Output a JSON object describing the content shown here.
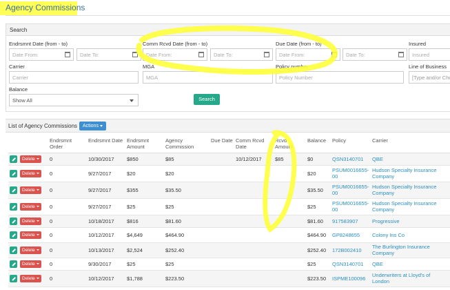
{
  "page": {
    "title": "Agency Commissions"
  },
  "search": {
    "heading": "Search",
    "endorsement_date_label": "Endrsmnt Date (from - to)",
    "comm_rcvd_date_label": "Comm Rcvd Date (from - to)",
    "due_date_label": "Due Date (from - to)",
    "insured_label": "Insured",
    "date_from_placeholder": "Date From:",
    "date_to_placeholder": "Date To:",
    "insured_placeholder": "Insured",
    "carrier_label": "Carrier",
    "carrier_placeholder": "Carrier",
    "mga_label": "MGA",
    "mga_placeholder": "MGA",
    "policy_number_label": "Policy number",
    "policy_number_placeholder": "Policy Number",
    "lob_label": "Line of Business",
    "lob_placeholder": "[Type and/or Che",
    "balance_label": "Balance",
    "balance_value": "Show All",
    "search_button": "Search"
  },
  "list": {
    "title": "List of Agency Commissions",
    "actions_button": "Actions",
    "delete_label": "Delete",
    "columns": [
      "",
      "Endrsmnt Order",
      "Endrsmnt Date",
      "Endrsmnt Amount",
      "Agency Commission",
      "Due Date",
      "Comm Rcvd Date",
      "Rcvd Amount",
      "Balance",
      "Policy",
      "Carrier"
    ],
    "rows": [
      {
        "order": "0",
        "date": "10/30/2017",
        "amount": "$850",
        "commission": "$85",
        "due": "",
        "comm_rcvd": "10/12/2017",
        "rcvd": "$85",
        "balance": "$0",
        "policy": "QSN3140701",
        "carrier": "QBE"
      },
      {
        "order": "0",
        "date": "9/27/2017",
        "amount": "$20",
        "commission": "$20",
        "due": "",
        "comm_rcvd": "",
        "rcvd": "",
        "balance": "$20",
        "policy": "PSUM0016655-00",
        "carrier": "Hudson Specialty Insurance Company"
      },
      {
        "order": "0",
        "date": "9/27/2017",
        "amount": "$355",
        "commission": "$35.50",
        "due": "",
        "comm_rcvd": "",
        "rcvd": "",
        "balance": "$35.50",
        "policy": "PSUM0016655-00",
        "carrier": "Hudson Specialty Insurance Company"
      },
      {
        "order": "0",
        "date": "9/27/2017",
        "amount": "$25",
        "commission": "$25",
        "due": "",
        "comm_rcvd": "",
        "rcvd": "",
        "balance": "$25",
        "policy": "PSUM0016655-00",
        "carrier": "Hudson Specialty Insurance Company"
      },
      {
        "order": "0",
        "date": "10/18/2017",
        "amount": "$816",
        "commission": "$81.60",
        "due": "",
        "comm_rcvd": "",
        "rcvd": "",
        "balance": "$81.60",
        "policy": "917583907",
        "carrier": "Progressive"
      },
      {
        "order": "0",
        "date": "10/12/2017",
        "amount": "$4,649",
        "commission": "$464.90",
        "due": "",
        "comm_rcvd": "",
        "rcvd": "",
        "balance": "$464.90",
        "policy": "GP8248655",
        "carrier": "Colony Ins Co"
      },
      {
        "order": "0",
        "date": "10/13/2017",
        "amount": "$2,524",
        "commission": "$252.40",
        "due": "",
        "comm_rcvd": "",
        "rcvd": "",
        "balance": "$252.40",
        "policy": "172B002410",
        "carrier": "The Burlington Insurance Company"
      },
      {
        "order": "0",
        "date": "9/30/2017",
        "amount": "$25",
        "commission": "$25",
        "due": "",
        "comm_rcvd": "",
        "rcvd": "",
        "balance": "$25",
        "policy": "QSN3140701",
        "carrier": "QBE"
      },
      {
        "order": "0",
        "date": "10/12/2017",
        "amount": "$1,788",
        "commission": "$223.50",
        "due": "",
        "comm_rcvd": "",
        "rcvd": "",
        "balance": "$223.50",
        "policy": "ISPME100096",
        "carrier": "Underwriters at Lloyd's of London"
      }
    ]
  },
  "colors": {
    "highlight": "#ffff3a",
    "primary": "#26a98a",
    "danger": "#d9534f",
    "link": "#2a8ec0",
    "actions": "#3d8fd1"
  }
}
